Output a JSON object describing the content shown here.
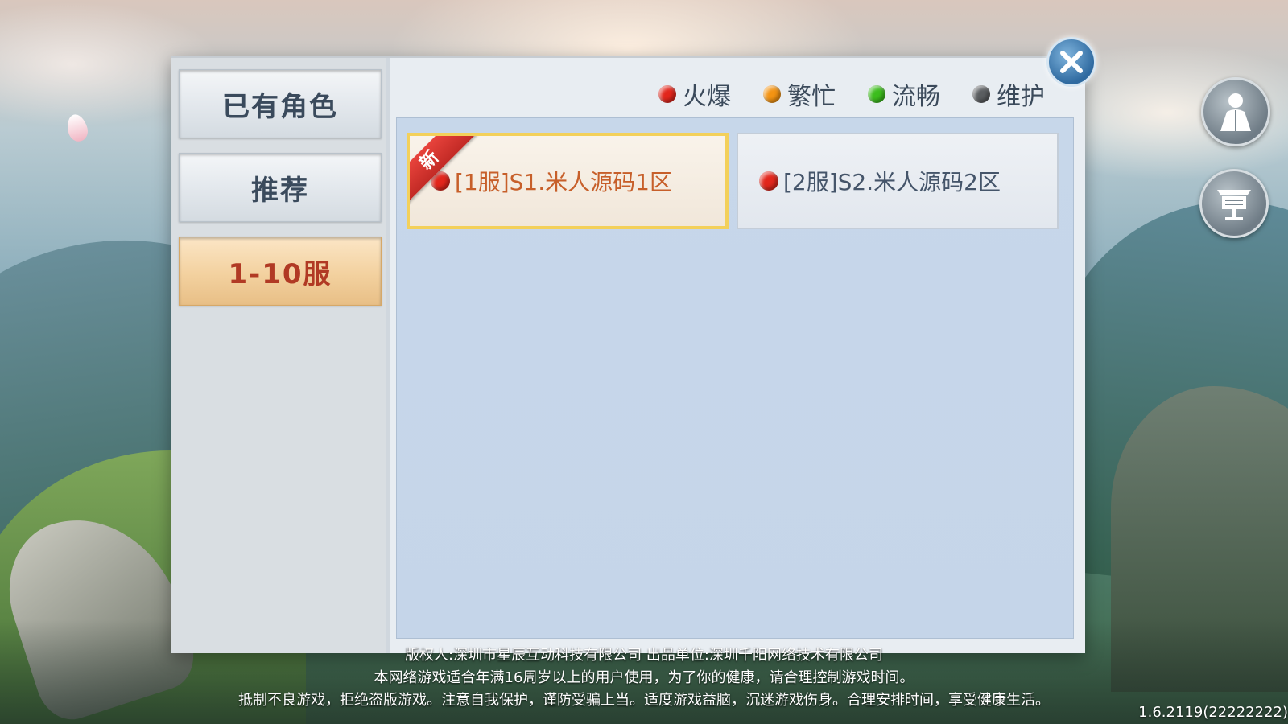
{
  "sidebar": {
    "tabs": [
      {
        "label": "已有角色",
        "active": false
      },
      {
        "label": "推荐",
        "active": false
      },
      {
        "label": "1-10服",
        "active": true
      }
    ]
  },
  "legend": [
    {
      "label": "火爆",
      "color": "#e2261c"
    },
    {
      "label": "繁忙",
      "color": "#f39312"
    },
    {
      "label": "流畅",
      "color": "#3cbd1d"
    },
    {
      "label": "维护",
      "color": "#5a5d60"
    }
  ],
  "servers": [
    {
      "name": "[1服]S1.米人源码1区",
      "status_color": "#e2261c",
      "badge": "新",
      "selected": true
    },
    {
      "name": "[2服]S2.米人源码2区",
      "status_color": "#e2261c",
      "selected": false
    }
  ],
  "footer": {
    "line1": "版权人:深圳市星辰互动科技有限公司   出品单位:深圳千阳网络技术有限公司",
    "line2": "本网络游戏适合年满16周岁以上的用户使用，为了你的健康，请合理控制游戏时间。",
    "line3": "抵制不良游戏，拒绝盗版游戏。注意自我保护，谨防受骗上当。适度游戏益脑，沉迷游戏伤身。合理安排时间，享受健康生活。"
  },
  "version": "1.6.2119(22222222)",
  "icons": {
    "close": "close-icon",
    "character": "character-icon",
    "notice": "notice-board-icon"
  }
}
